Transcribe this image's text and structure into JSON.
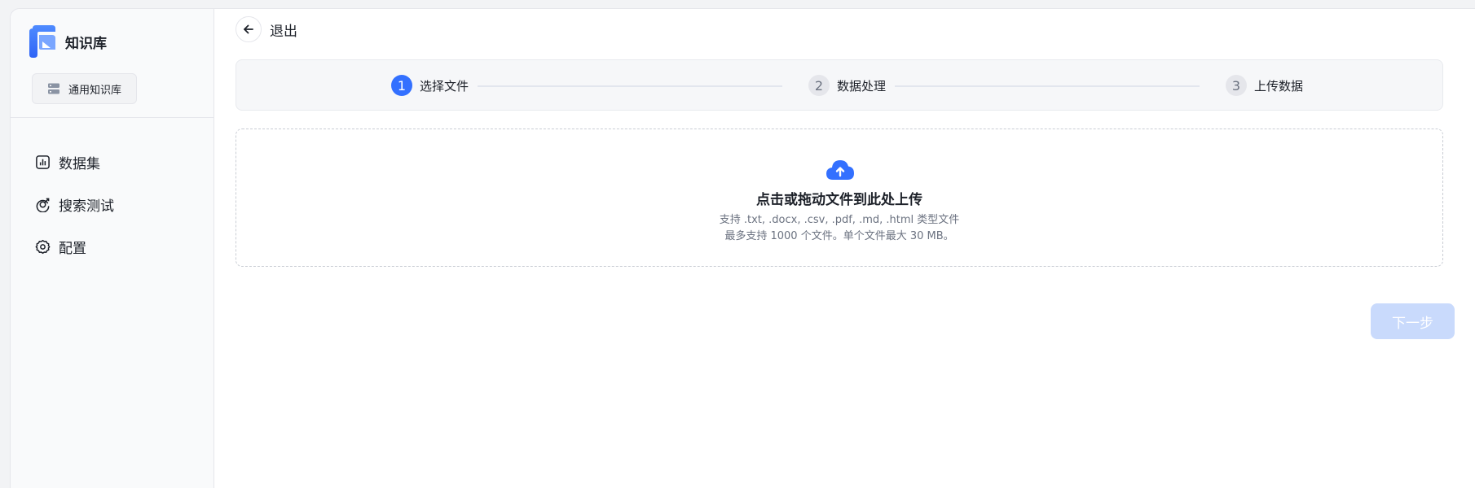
{
  "brand": {
    "title": "知识库"
  },
  "kb_chip": {
    "label": "通用知识库",
    "icon": "database-icon"
  },
  "nav": {
    "items": [
      {
        "label": "数据集",
        "icon": "bar-chart-icon"
      },
      {
        "label": "搜索测试",
        "icon": "search-test-icon"
      },
      {
        "label": "配置",
        "icon": "gear-icon"
      }
    ]
  },
  "back": {
    "label": "退出",
    "icon": "arrow-left-icon"
  },
  "steps": [
    {
      "num": "1",
      "label": "选择文件",
      "state": "active"
    },
    {
      "num": "2",
      "label": "数据处理",
      "state": "pending"
    },
    {
      "num": "3",
      "label": "上传数据",
      "state": "pending"
    }
  ],
  "upload": {
    "icon": "cloud-upload-icon",
    "title": "点击或拖动文件到此处上传",
    "formats": "支持 .txt, .docx, .csv, .pdf, .md, .html 类型文件",
    "limits": "最多支持 1000 个文件。单个文件最大 30 MB。"
  },
  "next_button": {
    "label": "下一步",
    "disabled": true
  },
  "colors": {
    "accent": "#3370ff",
    "accent_disabled": "#c9dafc",
    "sidebar_bg": "#f9fafb",
    "steps_bg": "#f6f7f9"
  }
}
